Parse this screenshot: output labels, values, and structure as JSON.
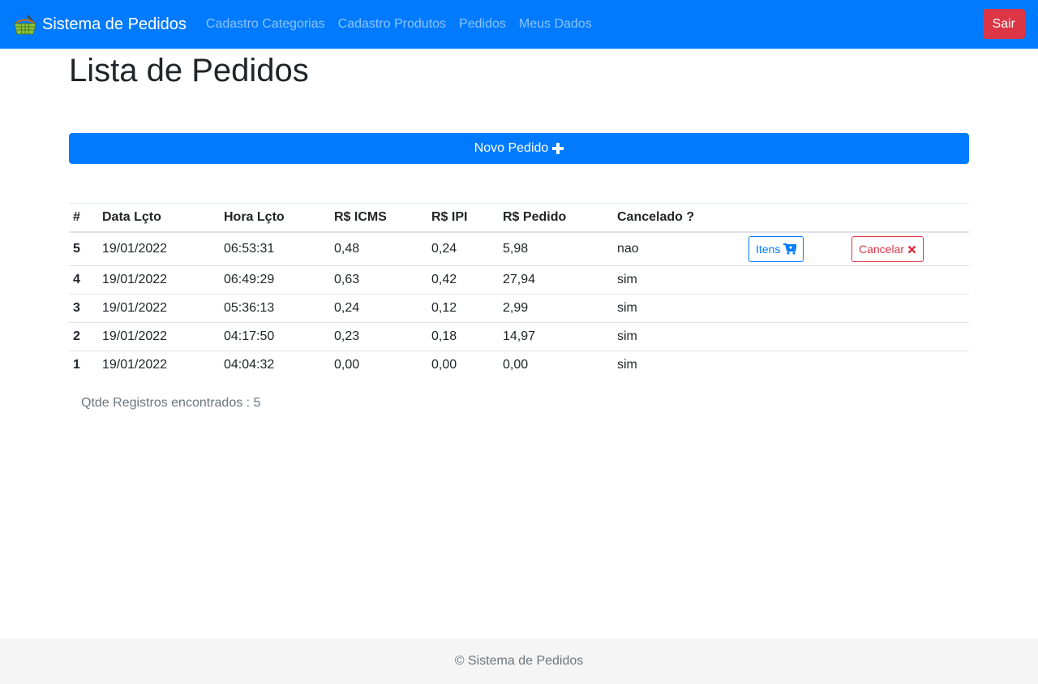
{
  "colors": {
    "primary": "#007bff",
    "danger": "#dc3545",
    "muted": "#6c757d",
    "footer_bg": "#f5f5f5"
  },
  "navbar": {
    "brand": "Sistema de Pedidos",
    "brand_icon": "shopping-basket-icon",
    "links": [
      "Cadastro Categorias",
      "Cadastro Produtos",
      "Pedidos",
      "Meus Dados"
    ],
    "logout_label": "Sair"
  },
  "page": {
    "title": "Lista de Pedidos",
    "new_order_label": "Novo Pedido",
    "new_order_icon": "plus-icon"
  },
  "table": {
    "headers": [
      "#",
      "Data Lçto",
      "Hora Lçto",
      "R$ ICMS",
      "R$ IPI",
      "R$ Pedido",
      "Cancelado ?"
    ],
    "rows": [
      {
        "id": "5",
        "data": "19/01/2022",
        "hora": "06:53:31",
        "icms": "0,48",
        "ipi": "0,24",
        "pedido": "5,98",
        "cancelado": "nao"
      },
      {
        "id": "4",
        "data": "19/01/2022",
        "hora": "06:49:29",
        "icms": "0,63",
        "ipi": "0,42",
        "pedido": "27,94",
        "cancelado": "sim"
      },
      {
        "id": "3",
        "data": "19/01/2022",
        "hora": "05:36:13",
        "icms": "0,24",
        "ipi": "0,12",
        "pedido": "2,99",
        "cancelado": "sim"
      },
      {
        "id": "2",
        "data": "19/01/2022",
        "hora": "04:17:50",
        "icms": "0,23",
        "ipi": "0,18",
        "pedido": "14,97",
        "cancelado": "sim"
      },
      {
        "id": "1",
        "data": "19/01/2022",
        "hora": "04:04:32",
        "icms": "0,00",
        "ipi": "0,00",
        "pedido": "0,00",
        "cancelado": "sim"
      }
    ],
    "itens_label": "Itens",
    "itens_icon": "cart-icon",
    "cancel_label": "Cancelar",
    "cancel_icon": "times-icon"
  },
  "count_text": "Qtde Registros encontrados : 5",
  "footer": "© Sistema de Pedidos"
}
